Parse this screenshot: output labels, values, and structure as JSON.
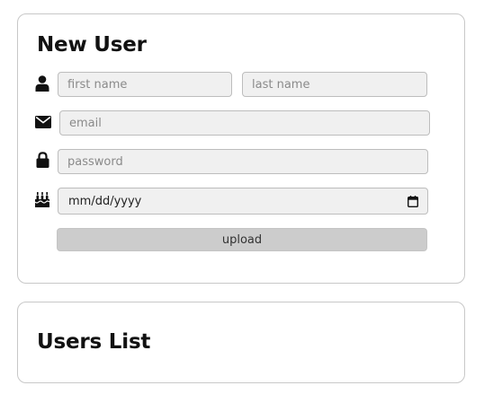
{
  "new_user": {
    "title": "New User",
    "first_name": {
      "placeholder": "first name",
      "value": ""
    },
    "last_name": {
      "placeholder": "last name",
      "value": ""
    },
    "email": {
      "placeholder": "email",
      "value": ""
    },
    "password": {
      "placeholder": "password",
      "value": ""
    },
    "birthday": {
      "value": "mm/dd/yyyy"
    },
    "upload_label": "upload",
    "icons": [
      "user-icon",
      "envelope-icon",
      "lock-icon",
      "birthday-cake-icon",
      "calendar-icon"
    ]
  },
  "users_list": {
    "title": "Users List"
  }
}
